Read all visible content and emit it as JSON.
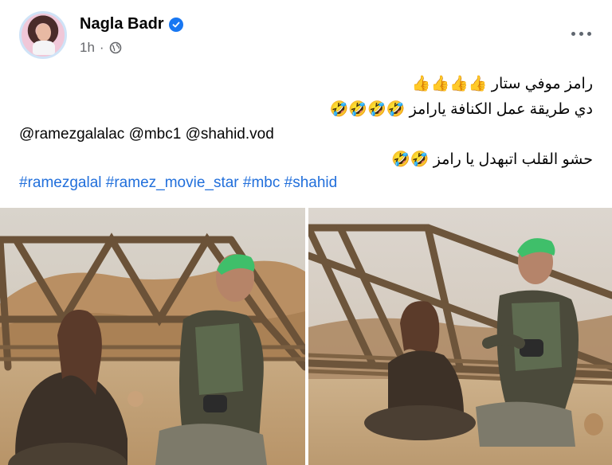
{
  "post": {
    "author": "Nagla Badr",
    "time": "1h",
    "privacy_icon": "globe-icon",
    "verified_icon": "verified-badge-icon",
    "more_icon": "more-options-icon",
    "lines": {
      "line1": "رامز موفي ستار 👍👍👍👍",
      "line2": "دي طريقة عمل الكنافة يارامز 🤣🤣🤣🤣",
      "mentions": "@ramezgalalac @mbc1 @shahid.vod",
      "line4": "حشو القلب اتبهدل يا رامز 🤣🤣"
    },
    "hashtags": [
      "#ramezgalal",
      "#ramez_movie_star",
      "#mbc",
      "#shahid"
    ]
  },
  "colors": {
    "link": "#216fdb",
    "verified": "#1877f2",
    "meta": "#65676b"
  }
}
